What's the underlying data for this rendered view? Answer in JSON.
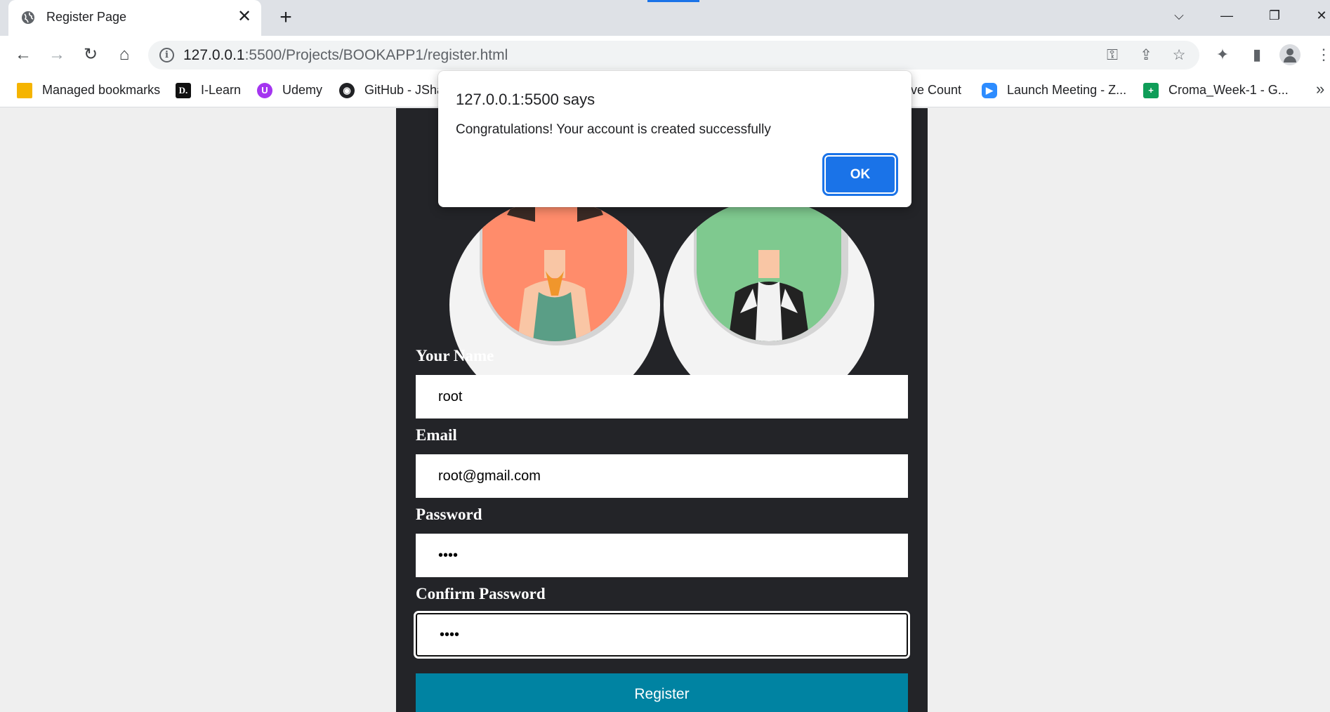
{
  "browser": {
    "tab_title": "Register Page",
    "url_host": "127.0.0.1",
    "url_rest": ":5500/Projects/BOOKAPP1/register.html",
    "bookmarks": [
      {
        "label": "Managed bookmarks",
        "icon": "folder-icon"
      },
      {
        "label": "I-Learn",
        "icon": "d-logo-icon"
      },
      {
        "label": "Udemy",
        "icon": "udemy-icon"
      },
      {
        "label": "GitHub - JSha",
        "icon": "github-icon"
      },
      {
        "label": "Live Count",
        "icon": "page-icon"
      },
      {
        "label": "Launch Meeting - Z...",
        "icon": "zoom-icon"
      },
      {
        "label": "Croma_Week-1 - G...",
        "icon": "sheets-icon"
      }
    ],
    "accent_color": "#1a73e8"
  },
  "dialog": {
    "title": "127.0.0.1:5500 says",
    "message": "Congratulations! Your account is created successfully",
    "ok_label": "OK"
  },
  "form": {
    "name_label": "Your Name",
    "name_value": "root",
    "email_label": "Email",
    "email_value": "root@gmail.com",
    "password_label": "Password",
    "password_value": "••••",
    "confirm_label": "Confirm Password",
    "confirm_value": "••••",
    "submit_label": "Register",
    "submit_color": "#0083a2",
    "card_color": "#232428"
  }
}
